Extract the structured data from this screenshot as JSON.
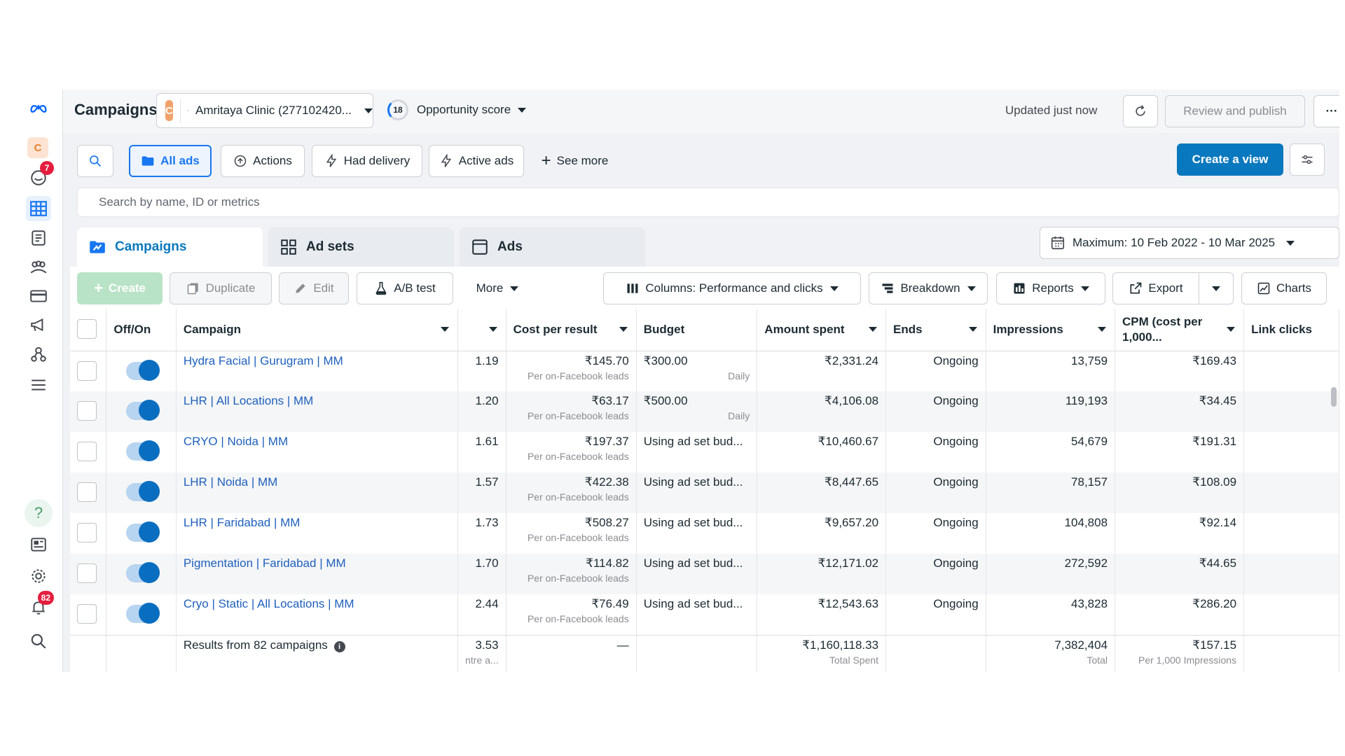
{
  "header": {
    "title": "Campaigns",
    "account_initial": "C",
    "account_name": "Amritaya Clinic (277102420...",
    "opportunity_score": "18",
    "opportunity_label": "Opportunity score",
    "updated": "Updated just now",
    "review_publish": "Review and publish",
    "more": "···"
  },
  "rail": {
    "avatar": "C",
    "alerts_badge": "7",
    "notifications_badge": "82",
    "help": "?"
  },
  "filters": {
    "all_ads": "All ads",
    "actions": "Actions",
    "had_delivery": "Had delivery",
    "active_ads": "Active ads",
    "see_more": "See more",
    "create_view": "Create a view",
    "search_placeholder": "Search by name, ID or metrics"
  },
  "tabs": {
    "campaigns": "Campaigns",
    "ad_sets": "Ad sets",
    "ads": "Ads"
  },
  "date_range": "Maximum: 10 Feb 2022 - 10 Mar 2025",
  "toolbar": {
    "create": "Create",
    "duplicate": "Duplicate",
    "edit": "Edit",
    "ab_test": "A/B test",
    "more": "More",
    "columns": "Columns: Performance and clicks",
    "breakdown": "Breakdown",
    "reports": "Reports",
    "export": "Export",
    "charts": "Charts"
  },
  "table": {
    "headers": {
      "off_on": "Off/On",
      "campaign": "Campaign",
      "results": "",
      "cost_per_result": "Cost per result",
      "budget": "Budget",
      "amount_spent": "Amount spent",
      "ends": "Ends",
      "impressions": "Impressions",
      "cpm": "CPM (cost per 1,000...",
      "link_clicks": "Link clicks"
    },
    "rows": [
      {
        "campaign": "Hydra Facial | Gurugram | MM",
        "results": "1.19",
        "cpr": "₹145.70",
        "cpr_sub": "Per on-Facebook leads",
        "budget": "₹300.00",
        "budget_sub": "Daily",
        "spent": "₹2,331.24",
        "ends": "Ongoing",
        "impressions": "13,759",
        "cpm": "₹169.43"
      },
      {
        "campaign": "LHR | All Locations | MM",
        "results": "1.20",
        "cpr": "₹63.17",
        "cpr_sub": "Per on-Facebook leads",
        "budget": "₹500.00",
        "budget_sub": "Daily",
        "spent": "₹4,106.08",
        "ends": "Ongoing",
        "impressions": "119,193",
        "cpm": "₹34.45"
      },
      {
        "campaign": "CRYO | Noida | MM",
        "results": "1.61",
        "cpr": "₹197.37",
        "cpr_sub": "Per on-Facebook leads",
        "budget": "Using ad set bud...",
        "budget_sub": "",
        "spent": "₹10,460.67",
        "ends": "Ongoing",
        "impressions": "54,679",
        "cpm": "₹191.31"
      },
      {
        "campaign": "LHR | Noida | MM",
        "results": "1.57",
        "cpr": "₹422.38",
        "cpr_sub": "Per on-Facebook leads",
        "budget": "Using ad set bud...",
        "budget_sub": "",
        "spent": "₹8,447.65",
        "ends": "Ongoing",
        "impressions": "78,157",
        "cpm": "₹108.09"
      },
      {
        "campaign": "LHR | Faridabad | MM",
        "results": "1.73",
        "cpr": "₹508.27",
        "cpr_sub": "Per on-Facebook leads",
        "budget": "Using ad set bud...",
        "budget_sub": "",
        "spent": "₹9,657.20",
        "ends": "Ongoing",
        "impressions": "104,808",
        "cpm": "₹92.14"
      },
      {
        "campaign": "Pigmentation | Faridabad | MM",
        "results": "1.70",
        "cpr": "₹114.82",
        "cpr_sub": "Per on-Facebook leads",
        "budget": "Using ad set bud...",
        "budget_sub": "",
        "spent": "₹12,171.02",
        "ends": "Ongoing",
        "impressions": "272,592",
        "cpm": "₹44.65"
      },
      {
        "campaign": "Cryo | Static | All Locations | MM",
        "results": "2.44",
        "cpr": "₹76.49",
        "cpr_sub": "Per on-Facebook leads",
        "budget": "Using ad set bud...",
        "budget_sub": "",
        "spent": "₹12,543.63",
        "ends": "Ongoing",
        "impressions": "43,828",
        "cpm": "₹286.20"
      }
    ],
    "footer": {
      "label": "Results from 82 campaigns",
      "results": "3.53",
      "results_sub": "ntre a...",
      "cpr": "—",
      "spent": "₹1,160,118.33",
      "spent_sub": "Total Spent",
      "impressions": "7,382,404",
      "impressions_sub": "Total",
      "cpm": "₹157.15",
      "cpm_sub": "Per 1,000 Impressions"
    }
  }
}
